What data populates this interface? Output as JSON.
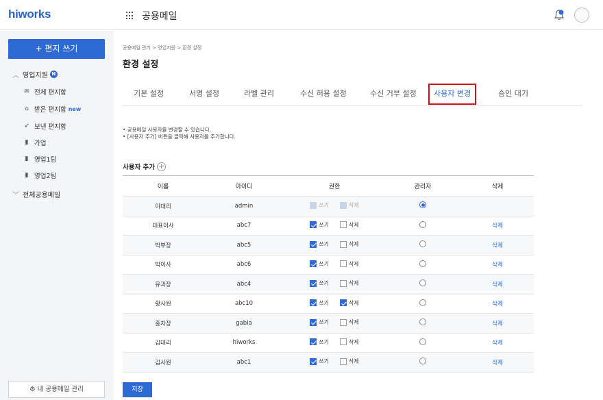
{
  "app": {
    "logo": "hiworks",
    "title": "공용메일"
  },
  "sidebar": {
    "compose_label": "+ 편지 쓰기",
    "group1": {
      "label": "영업지원",
      "badge": "N"
    },
    "items": [
      {
        "icon": "mail-icon",
        "label": "전체 편지함",
        "new": ""
      },
      {
        "icon": "inbox-icon",
        "label": "받은 편지함",
        "new": "new"
      },
      {
        "icon": "send-icon",
        "label": "보낸 편지함",
        "new": ""
      },
      {
        "icon": "bookmark-icon",
        "label": "가업",
        "new": ""
      },
      {
        "icon": "bookmark-icon",
        "label": "영업1팀",
        "new": ""
      },
      {
        "icon": "bookmark-icon",
        "label": "영업2팀",
        "new": ""
      }
    ],
    "group2": {
      "label": "전체공용메일"
    },
    "my_mgmt_label": "⚙ 내 공용메일 관리"
  },
  "breadcrumb": "공용메일 관리 > 영업지원 > 환경 설정",
  "page_title": "환경 설정",
  "tabs": [
    "기본 설정",
    "서명 설정",
    "라벨 관리",
    "수신 허용 설정",
    "수신 거부 설정",
    "사용자 변경",
    "승인 대기"
  ],
  "active_tab": "사용자 변경",
  "notes": [
    "• 공용메일 사용자를 변경할 수 있습니다.",
    "• [사용자 추가] 버튼을 클릭해 사용자를 추가합니다."
  ],
  "add_user_label": "사용자 추가",
  "table": {
    "headers": {
      "name": "이름",
      "id": "아이디",
      "perm": "권한",
      "admin": "관리자",
      "delete": "삭제"
    },
    "perm_write": "쓰기",
    "perm_delete": "삭제",
    "delete_link": "삭제",
    "rows": [
      {
        "name": "이대리",
        "id": "admin",
        "write": true,
        "del": true,
        "admin": true,
        "disabled": true
      },
      {
        "name": "대표이사",
        "id": "abc7",
        "write": true,
        "del": false,
        "admin": false,
        "disabled": false
      },
      {
        "name": "박부장",
        "id": "abc5",
        "write": true,
        "del": false,
        "admin": false,
        "disabled": false
      },
      {
        "name": "박이사",
        "id": "abc6",
        "write": true,
        "del": false,
        "admin": false,
        "disabled": false
      },
      {
        "name": "유과장",
        "id": "abc4",
        "write": true,
        "del": false,
        "admin": false,
        "disabled": false
      },
      {
        "name": "황사원",
        "id": "abc10",
        "write": true,
        "del": true,
        "admin": false,
        "disabled": false
      },
      {
        "name": "홍차장",
        "id": "gabia",
        "write": true,
        "del": false,
        "admin": false,
        "disabled": false
      },
      {
        "name": "김대리",
        "id": "hiworks",
        "write": true,
        "del": false,
        "admin": false,
        "disabled": false
      },
      {
        "name": "김사원",
        "id": "abc1",
        "write": true,
        "del": false,
        "admin": false,
        "disabled": false
      }
    ]
  },
  "save_label": "저장"
}
